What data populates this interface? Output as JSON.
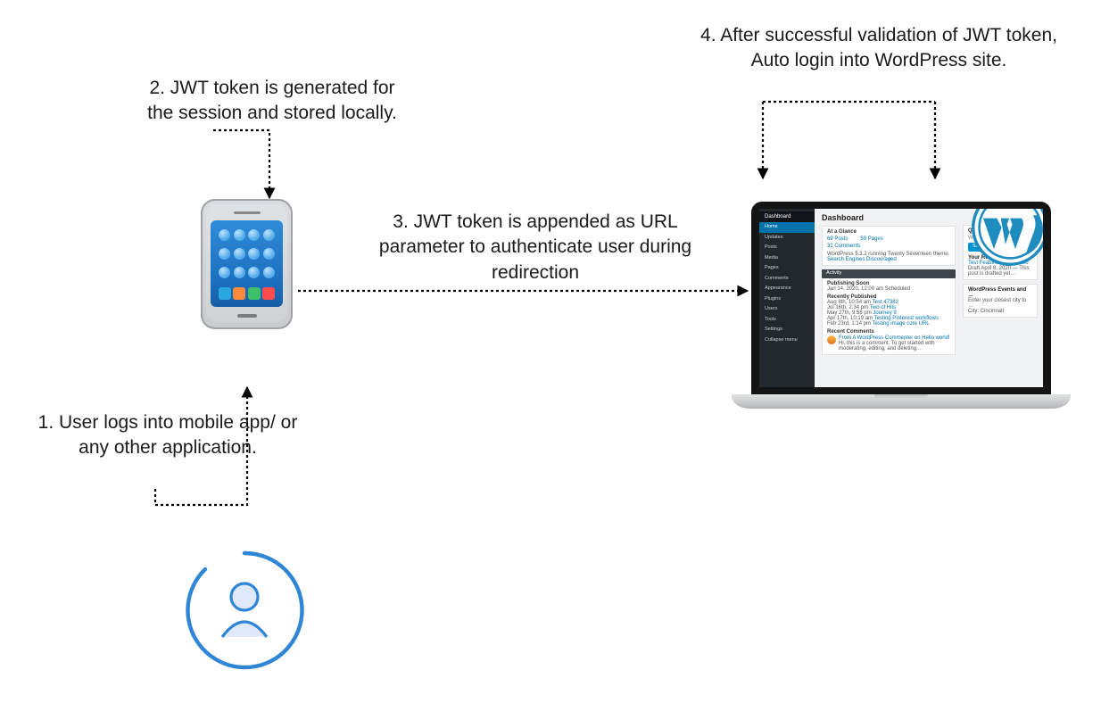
{
  "captions": {
    "c1": "1. User logs into mobile app/ or any other application.",
    "c2": "2. JWT token is generated for the session and stored locally.",
    "c3": "3. JWT token is appended as URL parameter to authenticate user during redirection",
    "c4": "4. After successful validation of JWT token, Auto login into WordPress site."
  },
  "phone": {
    "tile_colors": [
      "#2aa7e1",
      "#ff8a3c",
      "#3fbf6a",
      "#ff4d4d"
    ]
  },
  "wp": {
    "top_bar": "Dashboard",
    "sidebar": [
      {
        "label": "Home",
        "active": true
      },
      {
        "label": "Updates"
      },
      {
        "label": "Posts"
      },
      {
        "label": "Media"
      },
      {
        "label": "Pages"
      },
      {
        "label": "Comments"
      },
      {
        "label": "Appearance"
      },
      {
        "label": "Plugins"
      },
      {
        "label": "Users"
      },
      {
        "label": "Tools"
      },
      {
        "label": "Settings"
      },
      {
        "label": "Collapse menu"
      }
    ],
    "main_title": "Dashboard",
    "glance_title": "At a Glance",
    "glance_posts": "69 Posts",
    "glance_pages": "59 Pages",
    "glance_comments": "32 Comments",
    "glance_note1": "WordPress 5.3.2 running Twenty Seventeen theme.",
    "glance_note2": "Search Engines Discouraged",
    "activity_title": "Activity",
    "pub_soon": "Publishing Soon",
    "pub_soon_row": "Jan 14, 2020, 12:00 am   Scheduled",
    "recent_pub": "Recently Published",
    "recent_rows": [
      "Aug 8th, 10:54 am   Test 47382",
      "Jul 16th, 2:34 pm   Two of Hits",
      "May 27th, 9:58 pm   Journey 9",
      "Apr 17th, 10:19 am   Testing Pinterest workflows",
      "Feb 23rd, 1:14 pm   Testing image core URL"
    ],
    "recent_comments": "Recent Comments",
    "comment_line1": "From A WordPress Commenter on Hello world!",
    "comment_line2": "Hi, this is a comment. To get started with moderating, editing, and deleting…",
    "quick_draft": "Quick Draft",
    "draft_note": "What's on your mind?",
    "save_draft": "Save Draft",
    "your_drafts": "Your Recent Drafts",
    "draft1": "Test Featured Image Two",
    "draft2": "Draft April 8, 2020 — This post is drafted yet…",
    "events_title": "WordPress Events and …",
    "events_line": "Enter your closest city to …",
    "events_city": "City: Cincinnati"
  }
}
